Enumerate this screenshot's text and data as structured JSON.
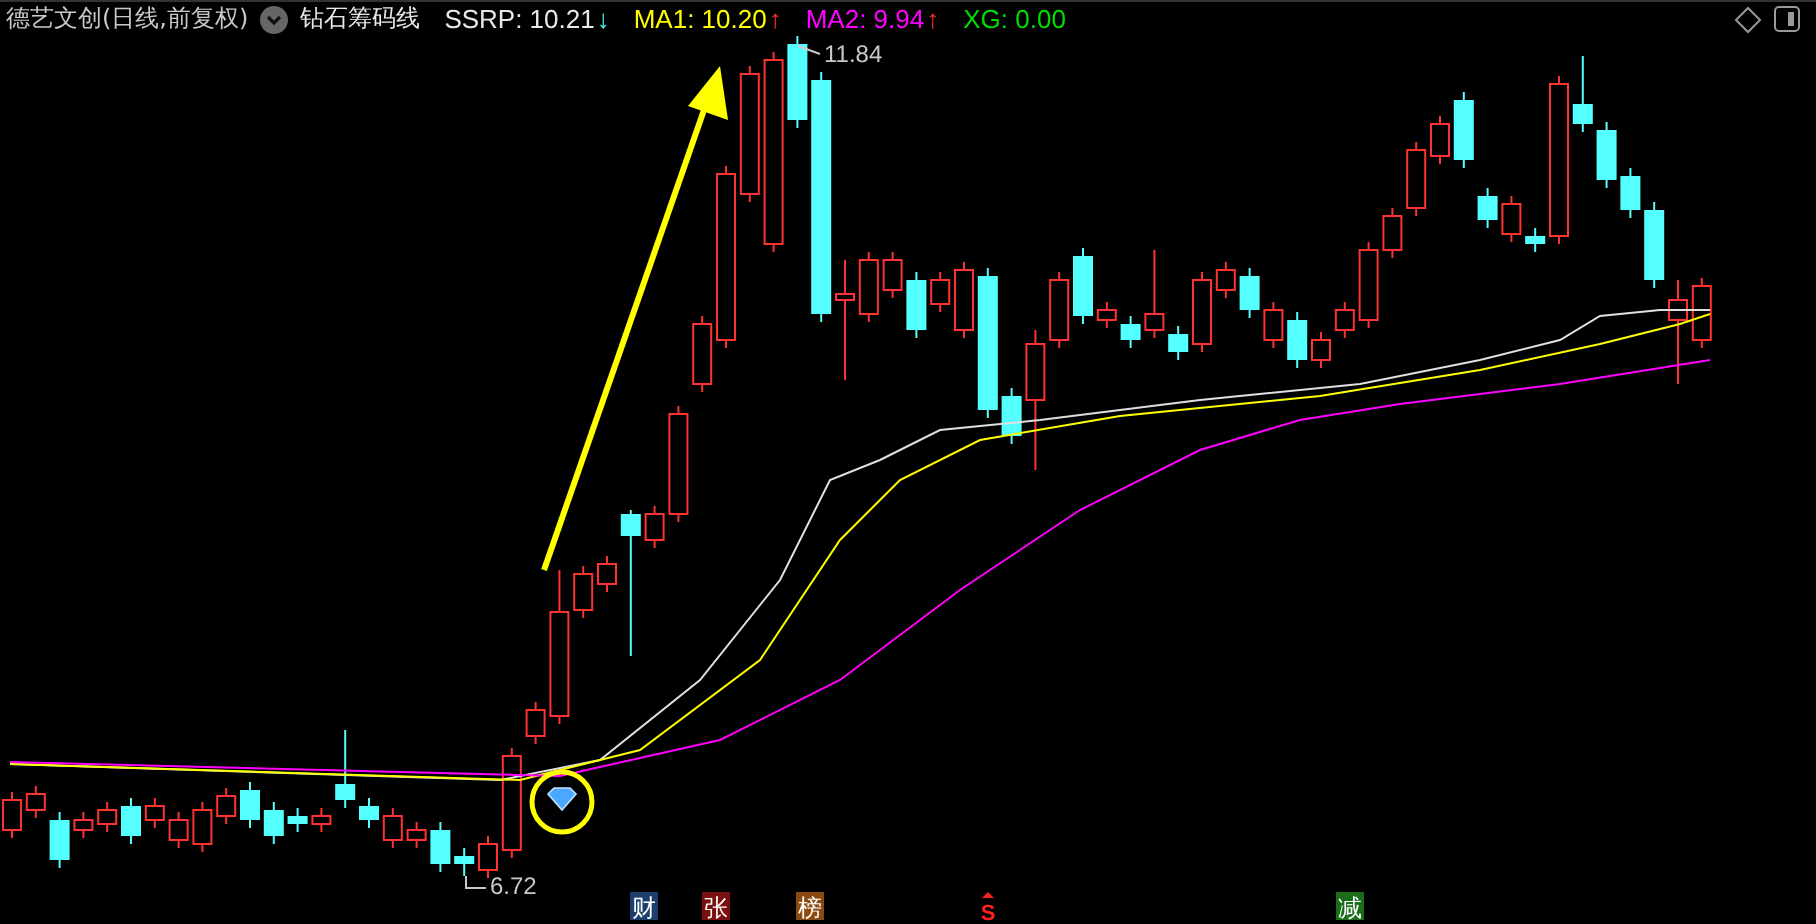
{
  "header": {
    "title": "德艺文创(日线,前复权)",
    "indicator": "钻石筹码线",
    "values": [
      {
        "label": "SSRP: 10.21",
        "arrow": {
          "text": "↓",
          "color": "#55ffff"
        },
        "color": "#e8e8e8"
      },
      {
        "label": "MA1: 10.20",
        "arrow": {
          "text": "↑",
          "color": "#ff3030"
        },
        "color": "#ffff00"
      },
      {
        "label": "MA2: 9.94",
        "arrow": {
          "text": "↑",
          "color": "#ff3030"
        },
        "color": "#ff00ff"
      },
      {
        "label": "XG: 0.00",
        "color": "#00dd00"
      }
    ]
  },
  "price_labels": [
    {
      "kind": "high",
      "text": "11.84"
    },
    {
      "kind": "low",
      "text": "6.72"
    }
  ],
  "markers": [
    {
      "kind": "tag",
      "text": "财",
      "color": "#1c3f6e"
    },
    {
      "kind": "tag",
      "text": "张",
      "color": "#7a1010"
    },
    {
      "kind": "tag",
      "text": "榜",
      "color": "#8a4a12"
    },
    {
      "kind": "signal",
      "text": "S",
      "color": "#ff2020"
    },
    {
      "kind": "tag",
      "text": "减",
      "color": "#1a6e1a"
    }
  ]
}
